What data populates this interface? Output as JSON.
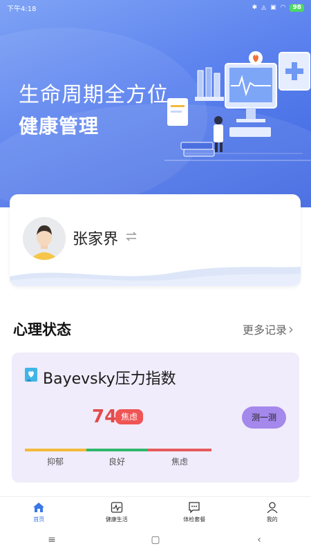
{
  "status_bar": {
    "time": "下午4:18",
    "battery": "98"
  },
  "hero": {
    "title_line1": "生命周期全方位",
    "title_line2": "健康管理"
  },
  "profile": {
    "name": "张家界",
    "switch_icon": "switch-arrows-icon"
  },
  "section": {
    "title": "心理状态",
    "more_label": "更多记录"
  },
  "stress_card": {
    "title": "Bayevsky压力指数",
    "score": "74",
    "status": "焦虑",
    "measure_button": "测一测",
    "scale": [
      {
        "label": "抑郁",
        "color": "#f3b93a"
      },
      {
        "label": "良好",
        "color": "#2fb86c"
      },
      {
        "label": "焦虑",
        "color": "#e55b5b"
      }
    ]
  },
  "tabs": [
    {
      "label": "首页",
      "icon": "home-icon",
      "active": true
    },
    {
      "label": "健康生活",
      "icon": "heartbeat-icon",
      "active": false
    },
    {
      "label": "体检套餐",
      "icon": "chat-bubble-icon",
      "active": false
    },
    {
      "label": "我的",
      "icon": "user-icon",
      "active": false
    }
  ],
  "system_nav": {
    "menu": "≡",
    "home": "▢",
    "back": "‹"
  },
  "colors": {
    "primary": "#3a78e8",
    "score_red": "#e24b4b",
    "button_purple": "#a588ec",
    "card_bg": "#f0ecfb"
  }
}
